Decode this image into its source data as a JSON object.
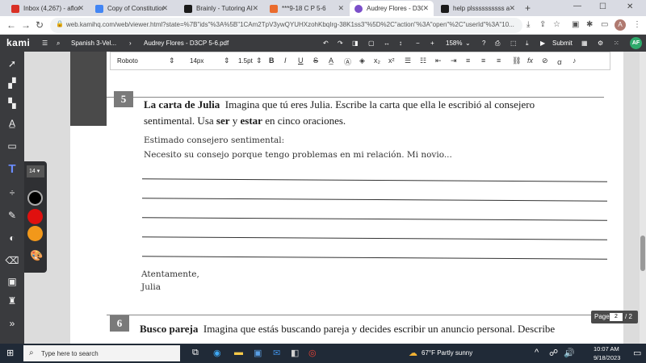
{
  "browser": {
    "tabs": [
      {
        "label": "Inbox (4,267) - aflores@",
        "color": "#d93025"
      },
      {
        "label": "Copy of Constitution: S",
        "color": "#4285f4"
      },
      {
        "label": "Brainly - Tutoring AI",
        "color": "#1a1a1a"
      },
      {
        "label": "***9-18 C P 5-6",
        "color": "#ea6b2d"
      },
      {
        "label": "Audrey Flores - D3CP",
        "color": "#7b4fc9"
      },
      {
        "label": "help plssssssssss as",
        "color": "#1a1a1a"
      }
    ],
    "new_tab": "+",
    "url": "web.kamihq.com/web/viewer.html?state=%7B\"ids\"%3A%5B\"1CAm2TpV3ywQYUHXzohKbqIrg-38K1ss3\"%5D%2C\"action\"%3A\"open\"%2C\"userId\"%3A\"10...",
    "profile_initial": "A"
  },
  "kami": {
    "logo": "kami",
    "breadcrumb_1": "Spanish 3-Vel...",
    "doc_title": "Audrey Flores - D3CP 5-6.pdf",
    "zoom": "158%",
    "submit": "Submit",
    "user_initials": "AF"
  },
  "format_bar": {
    "font": "Roboto",
    "size": "14px",
    "line_height": "1.5pt"
  },
  "palette": {
    "font_size": "14",
    "colors": [
      "#000000",
      "#e0100f",
      "#f2981a"
    ]
  },
  "document": {
    "sec5": {
      "number": "5",
      "heading": "La carta de Julia",
      "prompt_line1": "Imagina que tú eres Julia. Escribe la carta que ella le escribió al consejero",
      "prompt_line2a": "sentimental. Usa",
      "ser": "ser",
      "y": "y",
      "estar": "estar",
      "prompt_line2b": "en cinco oraciones.",
      "salutation": "Estimado consejero sentimental:",
      "body_start": "Necesito su consejo porque tengo problemas en mi relación. Mi novio...",
      "closing": "Atentamente,",
      "signature": "Julia"
    },
    "sec6": {
      "number": "6",
      "heading": "Busco pareja",
      "prompt": "Imagina que estás buscando pareja y decides escribir un anuncio personal. Describe"
    },
    "page_label": "Page",
    "page_current": "2",
    "page_total": "/ 2"
  },
  "taskbar": {
    "search_placeholder": "Type here to search",
    "weather": "67°F  Partly sunny",
    "time": "10:07 AM",
    "date": "9/18/2023"
  }
}
